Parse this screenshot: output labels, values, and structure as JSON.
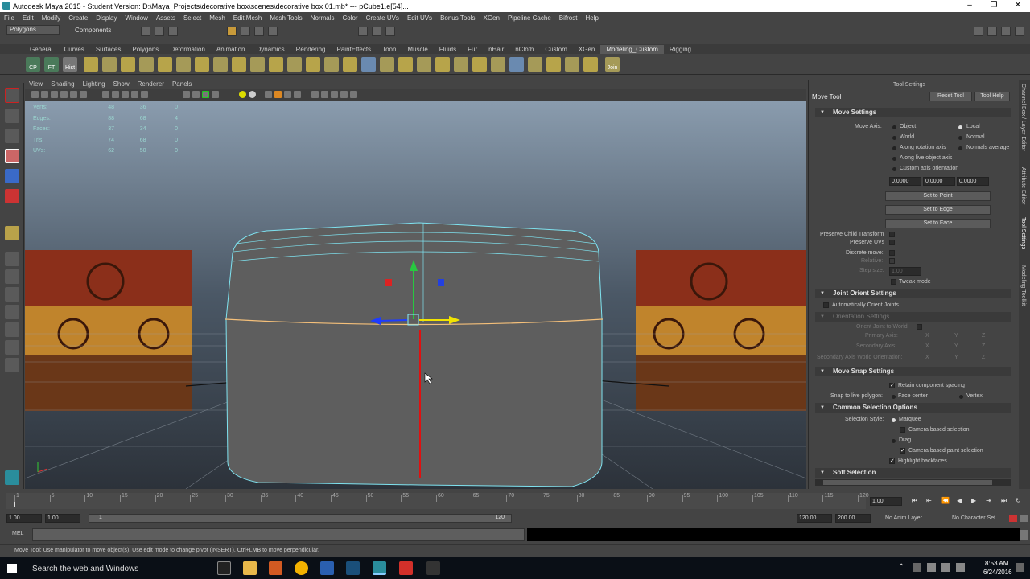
{
  "window": {
    "title": "Autodesk Maya 2015 - Student Version: D:\\Maya_Projects\\decorative box\\scenes\\decorative box 01.mb*  ---  pCube1.e[54]...",
    "minimize": "–",
    "maximize": "❐",
    "close": "✕"
  },
  "menu": [
    "File",
    "Edit",
    "Modify",
    "Create",
    "Display",
    "Window",
    "Assets",
    "Select",
    "Mesh",
    "Edit Mesh",
    "Mesh Tools",
    "Normals",
    "Color",
    "Create UVs",
    "Edit UVs",
    "Bonus Tools",
    "XGen",
    "Pipeline Cache",
    "Bifrost",
    "Help"
  ],
  "status": {
    "menuset": "Polygons",
    "selection_mode": "Components"
  },
  "shelf": {
    "tabs": [
      "General",
      "Curves",
      "Surfaces",
      "Polygons",
      "Deformation",
      "Animation",
      "Dynamics",
      "Rendering",
      "PaintEffects",
      "Toon",
      "Muscle",
      "Fluids",
      "Fur",
      "nHair",
      "nCloth",
      "Custom",
      "XGen",
      "Modeling_Custom",
      "Rigging"
    ],
    "active": "Modeling_Custom",
    "labels": {
      "cp": "CP",
      "ft": "FT",
      "hist": "Hist",
      "join": "Join"
    }
  },
  "viewport": {
    "menu": [
      "View",
      "Shading",
      "Lighting",
      "Show",
      "Renderer",
      "Panels"
    ],
    "hud": [
      {
        "label": "Verts:",
        "a": "48",
        "b": "36",
        "c": "0"
      },
      {
        "label": "Edges:",
        "a": "88",
        "b": "68",
        "c": "4"
      },
      {
        "label": "Faces:",
        "a": "37",
        "b": "34",
        "c": "0"
      },
      {
        "label": "Tris:",
        "a": "74",
        "b": "68",
        "c": "0"
      },
      {
        "label": "UVs:",
        "a": "62",
        "b": "50",
        "c": "0"
      }
    ]
  },
  "tool_settings": {
    "header": "Tool Settings",
    "tool_name": "Move Tool",
    "reset_button": "Reset Tool",
    "help_button": "Tool Help",
    "move_settings": {
      "title": "Move Settings",
      "move_axis_label": "Move Axis:",
      "options": [
        "Object",
        "Local",
        "World",
        "Normal",
        "Along rotation axis",
        "Normals average",
        "Along live object axis",
        "Custom axis orientation"
      ],
      "selected": "Local",
      "custom_values": [
        "0.0000",
        "0.0000",
        "0.0000"
      ],
      "set_point": "Set to Point",
      "set_edge": "Set to Edge",
      "set_face": "Set to Face",
      "preserve_child": "Preserve Child Transform",
      "preserve_uvs": "Preserve UVs",
      "discrete_move": "Discrete move:",
      "relative": "Relative:",
      "step_size": "Step size:",
      "step_value": "1.00",
      "tweak_mode": "Tweak mode"
    },
    "joint_orient": {
      "title": "Joint Orient Settings",
      "auto_orient": "Automatically Orient Joints",
      "orientation_settings": "Orientation Settings",
      "orient_to_world": "Orient Joint to World:",
      "primary_axis": "Primary Axis:",
      "secondary_axis": "Secondary Axis:",
      "secondary_world": "Secondary Axis World Orientation:",
      "x": "X",
      "y": "Y",
      "z": "Z"
    },
    "move_snap": {
      "title": "Move Snap Settings",
      "retain_spacing": "Retain component spacing",
      "snap_live": "Snap to live polygon:",
      "face_center": "Face center",
      "vertex": "Vertex"
    },
    "common_selection": {
      "title": "Common Selection Options",
      "selection_style": "Selection Style:",
      "marquee": "Marquee",
      "camera_based": "Camera based selection",
      "drag": "Drag",
      "camera_paint": "Camera based paint selection",
      "highlight_backfaces": "Highlight backfaces"
    },
    "soft_selection": {
      "title": "Soft Selection"
    }
  },
  "side_tabs": [
    "Channel Box / Layer Editor",
    "Attribute Editor",
    "Tool Settings",
    "Modeling Toolkit"
  ],
  "timeline": {
    "ticks": [
      "1",
      "5",
      "10",
      "15",
      "20",
      "25",
      "30",
      "35",
      "40",
      "45",
      "50",
      "55",
      "60",
      "65",
      "70",
      "75",
      "80",
      "85",
      "90",
      "95",
      "100",
      "105",
      "110",
      "115",
      "120"
    ],
    "current": "1.00"
  },
  "range": {
    "start": "1.00",
    "start2": "1.00",
    "range_start": "1",
    "range_end": "120",
    "end": "120.00",
    "end2": "200.00",
    "anim_layer": "No Anim Layer",
    "char_set": "No Character Set"
  },
  "cmd": {
    "label": "MEL"
  },
  "help": "Move Tool: Use manipulator to move object(s). Use edit mode to change pivot (INSERT).  Ctrl+LMB to move perpendicular.",
  "taskbar": {
    "search": "Search the web and Windows",
    "time": "8:53 AM",
    "date": "6/24/2016"
  }
}
